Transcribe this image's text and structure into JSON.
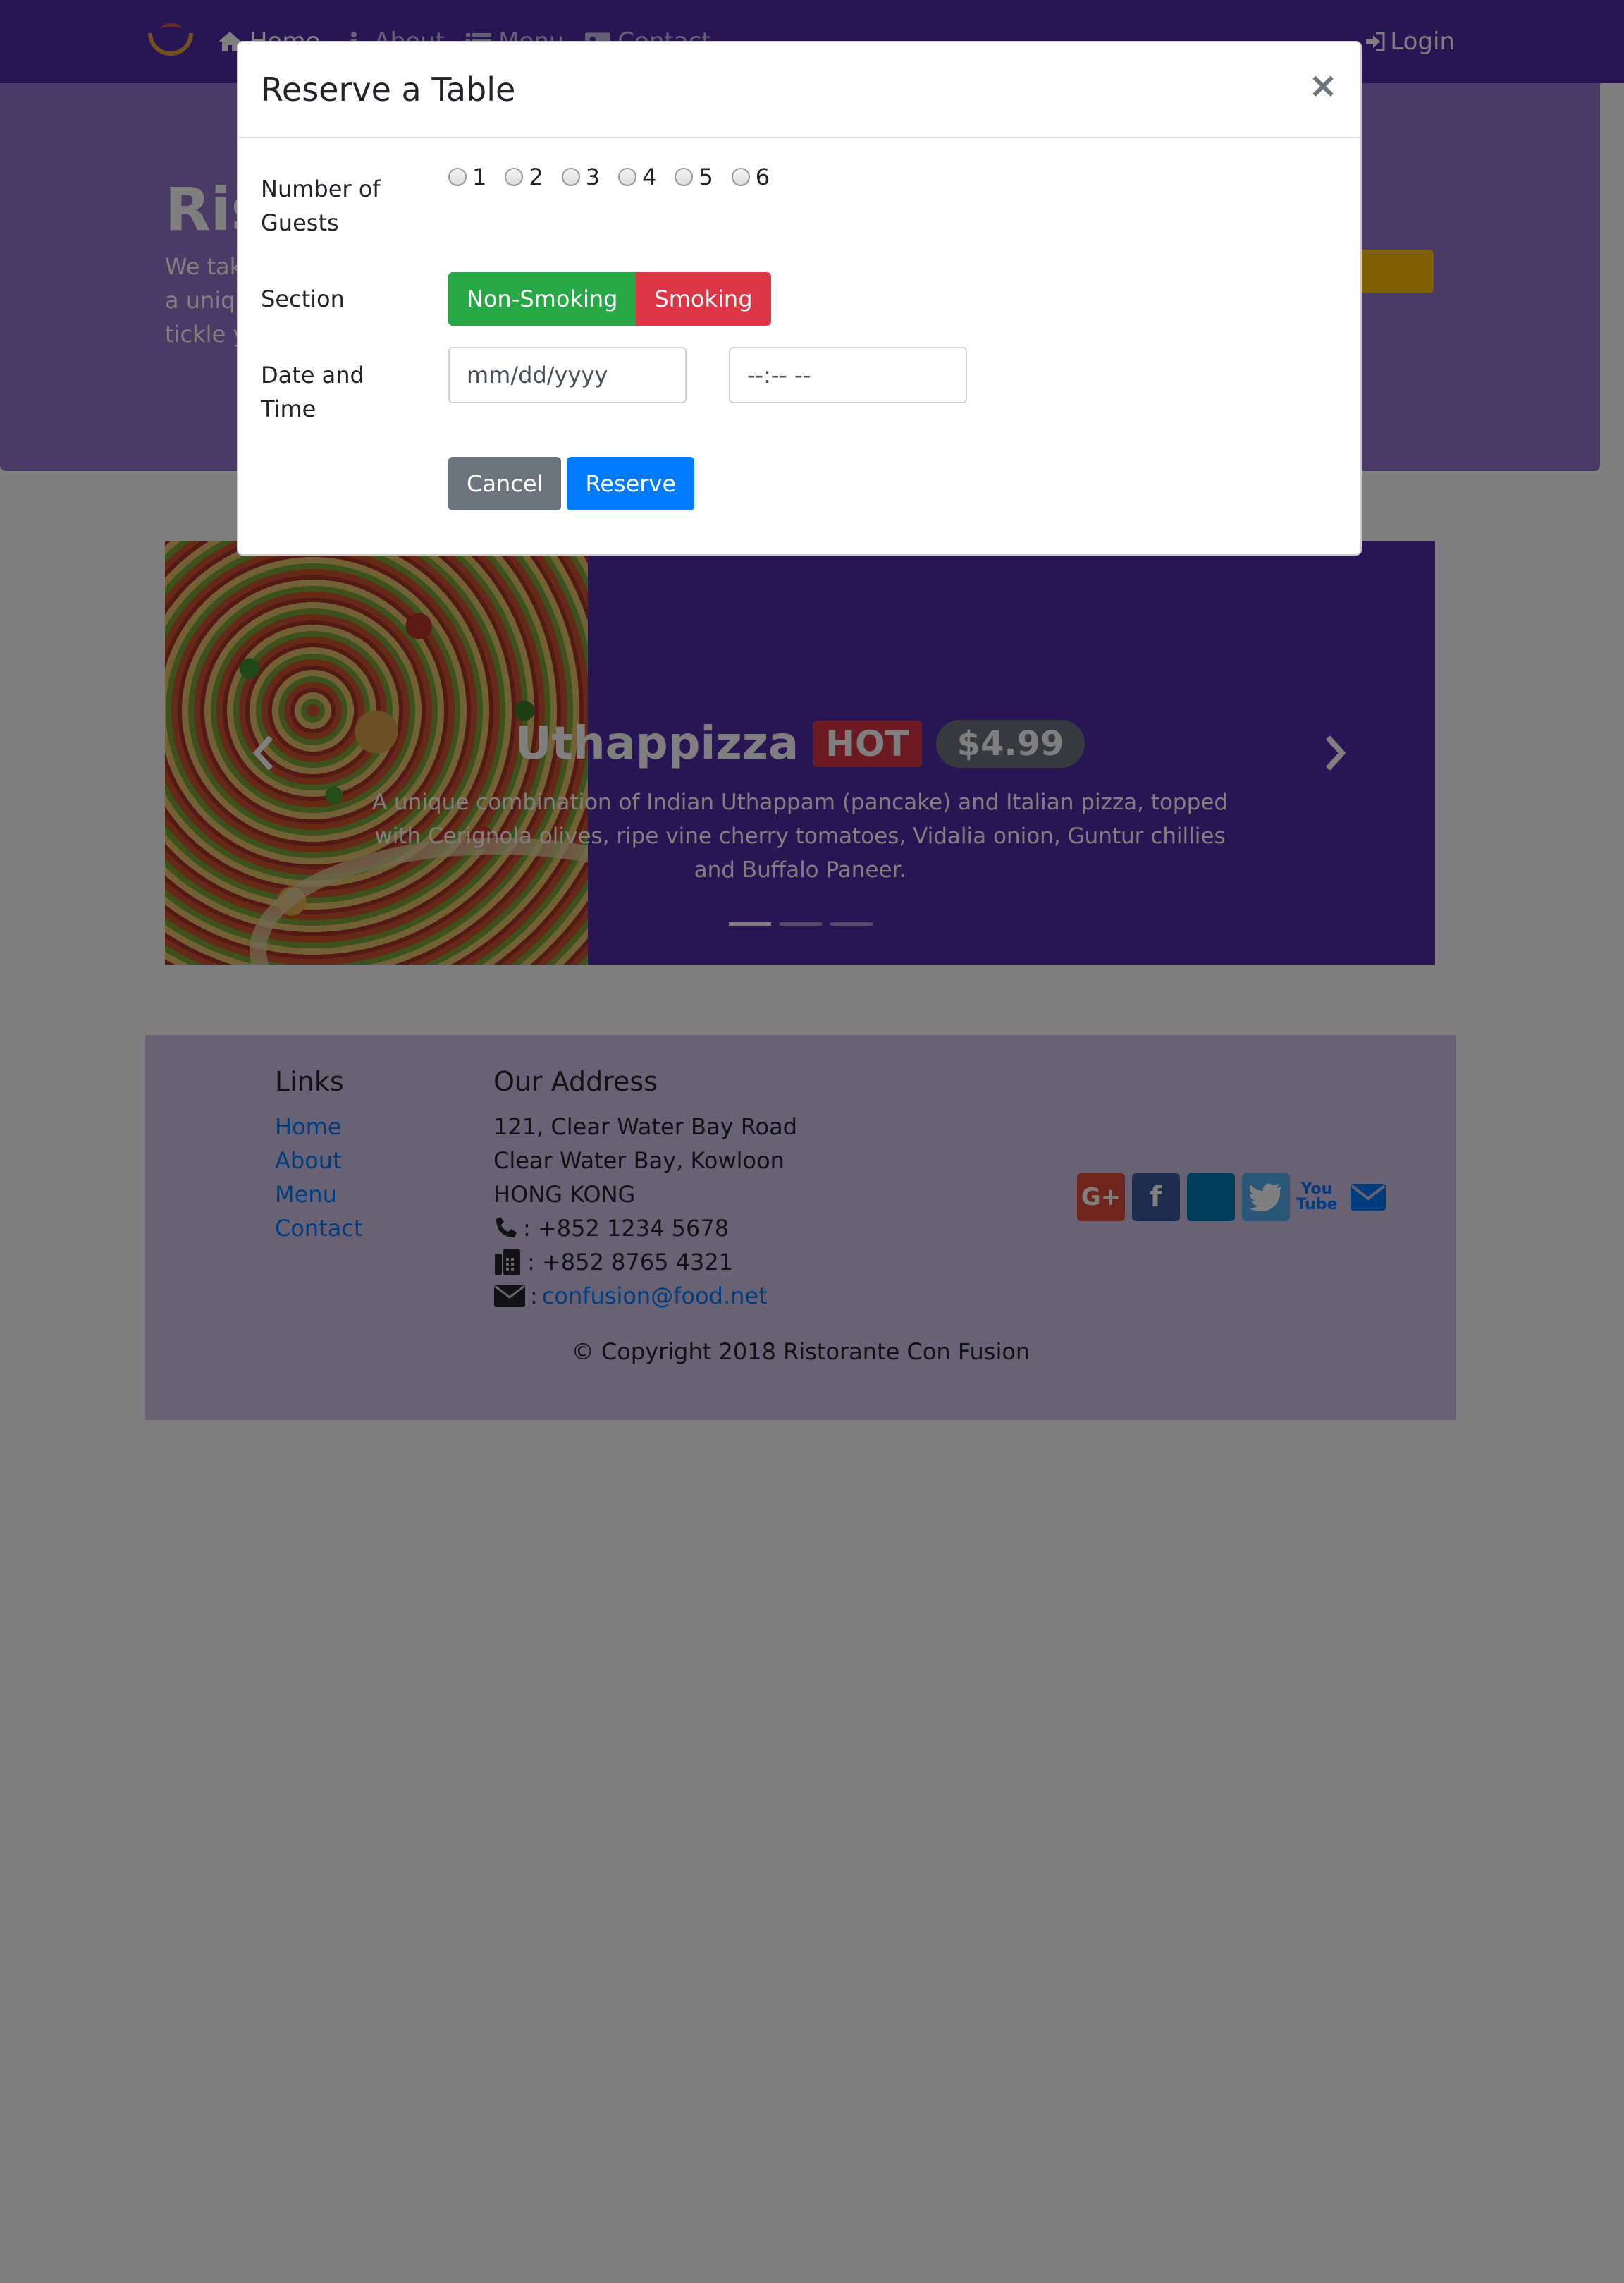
{
  "navbar": {
    "items": [
      {
        "label": "Home",
        "icon": "home-icon"
      },
      {
        "label": "About",
        "icon": "info-icon"
      },
      {
        "label": "Menu",
        "icon": "list-icon"
      },
      {
        "label": "Contact",
        "icon": "address-card-icon"
      }
    ],
    "login_label": "Login"
  },
  "jumbotron": {
    "title": "Ris",
    "text": [
      "We tak",
      "a uniqu",
      "tickle y"
    ]
  },
  "carousel": {
    "dish_name": "Uthappizza",
    "badge": "HOT",
    "price": "$4.99",
    "description": "A unique combination of Indian Uthappam (pancake) and Italian pizza, topped with Cerignola olives, ripe vine cherry tomatoes, Vidalia onion, Guntur chillies and Buffalo Paneer.",
    "active_slide": 0,
    "slide_count": 3
  },
  "footer": {
    "links_heading": "Links",
    "links": [
      "Home",
      "About",
      "Menu",
      "Contact"
    ],
    "address_heading": "Our Address",
    "address_lines": [
      "121, Clear Water Bay Road",
      "Clear Water Bay, Kowloon",
      "HONG KONG"
    ],
    "phone": ": +852 1234 5678",
    "fax": ": +852 8765 4321",
    "email_prefix": ":",
    "email": "confusion@food.net",
    "social": [
      "google-plus",
      "facebook",
      "linkedin",
      "twitter",
      "youtube",
      "mail"
    ],
    "copyright": "© Copyright 2018 Ristorante Con Fusion"
  },
  "modal": {
    "title": "Reserve a Table",
    "close_label": "×",
    "guests_label": "Number of Guests",
    "guest_options": [
      "1",
      "2",
      "3",
      "4",
      "5",
      "6"
    ],
    "section_label": "Section",
    "section_options": [
      "Non-Smoking",
      "Smoking"
    ],
    "datetime_label": "Date and Time",
    "date_placeholder": "mm/dd/yyyy",
    "time_placeholder": "--:-- --",
    "cancel_label": "Cancel",
    "reserve_label": "Reserve"
  },
  "colors": {
    "primary": "#512da8",
    "jumbotron": "#9575cd",
    "footer": "#d1c4e9",
    "success": "#28a745",
    "danger": "#dc3545",
    "secondary": "#6c757d",
    "link": "#007bff"
  }
}
